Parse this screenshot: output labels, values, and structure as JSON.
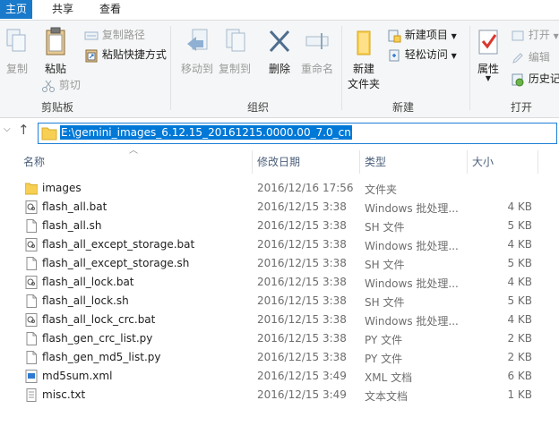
{
  "tabs": [
    "主页",
    "共享",
    "查看"
  ],
  "ribbon": {
    "clipboard": {
      "copy": "复制",
      "paste": "粘贴",
      "copy_path": "复制路径",
      "paste_shortcut": "粘贴快捷方式",
      "cut": "剪切",
      "label": "剪贴板"
    },
    "organize": {
      "move_to": "移动到",
      "copy_to": "复制到",
      "delete": "删除",
      "rename": "重命名",
      "label": "组织"
    },
    "new": {
      "new_folder_line1": "新建",
      "new_folder_line2": "文件夹",
      "new_item": "新建项目",
      "easy_access": "轻松访问",
      "label": "新建"
    },
    "open": {
      "properties": "属性",
      "open": "打开",
      "edit": "编辑",
      "history": "历史记",
      "label": "打开"
    }
  },
  "address": {
    "path": "E:\\gemini_images_6.12.15_20161215.0000.00_7.0_cn"
  },
  "columns": {
    "name": "名称",
    "modified": "修改日期",
    "type": "类型",
    "size": "大小"
  },
  "files": [
    {
      "name": "images",
      "date": "2016/12/16 17:56",
      "type": "文件夹",
      "size": "",
      "icon": "folder-icon"
    },
    {
      "name": "flash_all.bat",
      "date": "2016/12/15 3:38",
      "type": "Windows 批处理...",
      "size": "4 KB",
      "icon": "batch-file-icon"
    },
    {
      "name": "flash_all.sh",
      "date": "2016/12/15 3:38",
      "type": "SH 文件",
      "size": "5 KB",
      "icon": "file-icon"
    },
    {
      "name": "flash_all_except_storage.bat",
      "date": "2016/12/15 3:38",
      "type": "Windows 批处理...",
      "size": "4 KB",
      "icon": "batch-file-icon"
    },
    {
      "name": "flash_all_except_storage.sh",
      "date": "2016/12/15 3:38",
      "type": "SH 文件",
      "size": "5 KB",
      "icon": "file-icon"
    },
    {
      "name": "flash_all_lock.bat",
      "date": "2016/12/15 3:38",
      "type": "Windows 批处理...",
      "size": "4 KB",
      "icon": "batch-file-icon"
    },
    {
      "name": "flash_all_lock.sh",
      "date": "2016/12/15 3:38",
      "type": "SH 文件",
      "size": "5 KB",
      "icon": "file-icon"
    },
    {
      "name": "flash_all_lock_crc.bat",
      "date": "2016/12/15 3:38",
      "type": "Windows 批处理...",
      "size": "4 KB",
      "icon": "batch-file-icon"
    },
    {
      "name": "flash_gen_crc_list.py",
      "date": "2016/12/15 3:38",
      "type": "PY 文件",
      "size": "2 KB",
      "icon": "file-icon"
    },
    {
      "name": "flash_gen_md5_list.py",
      "date": "2016/12/15 3:38",
      "type": "PY 文件",
      "size": "2 KB",
      "icon": "file-icon"
    },
    {
      "name": "md5sum.xml",
      "date": "2016/12/15 3:49",
      "type": "XML 文档",
      "size": "6 KB",
      "icon": "xml-file-icon"
    },
    {
      "name": "misc.txt",
      "date": "2016/12/15 3:49",
      "type": "文本文档",
      "size": "1 KB",
      "icon": "text-file-icon"
    }
  ]
}
